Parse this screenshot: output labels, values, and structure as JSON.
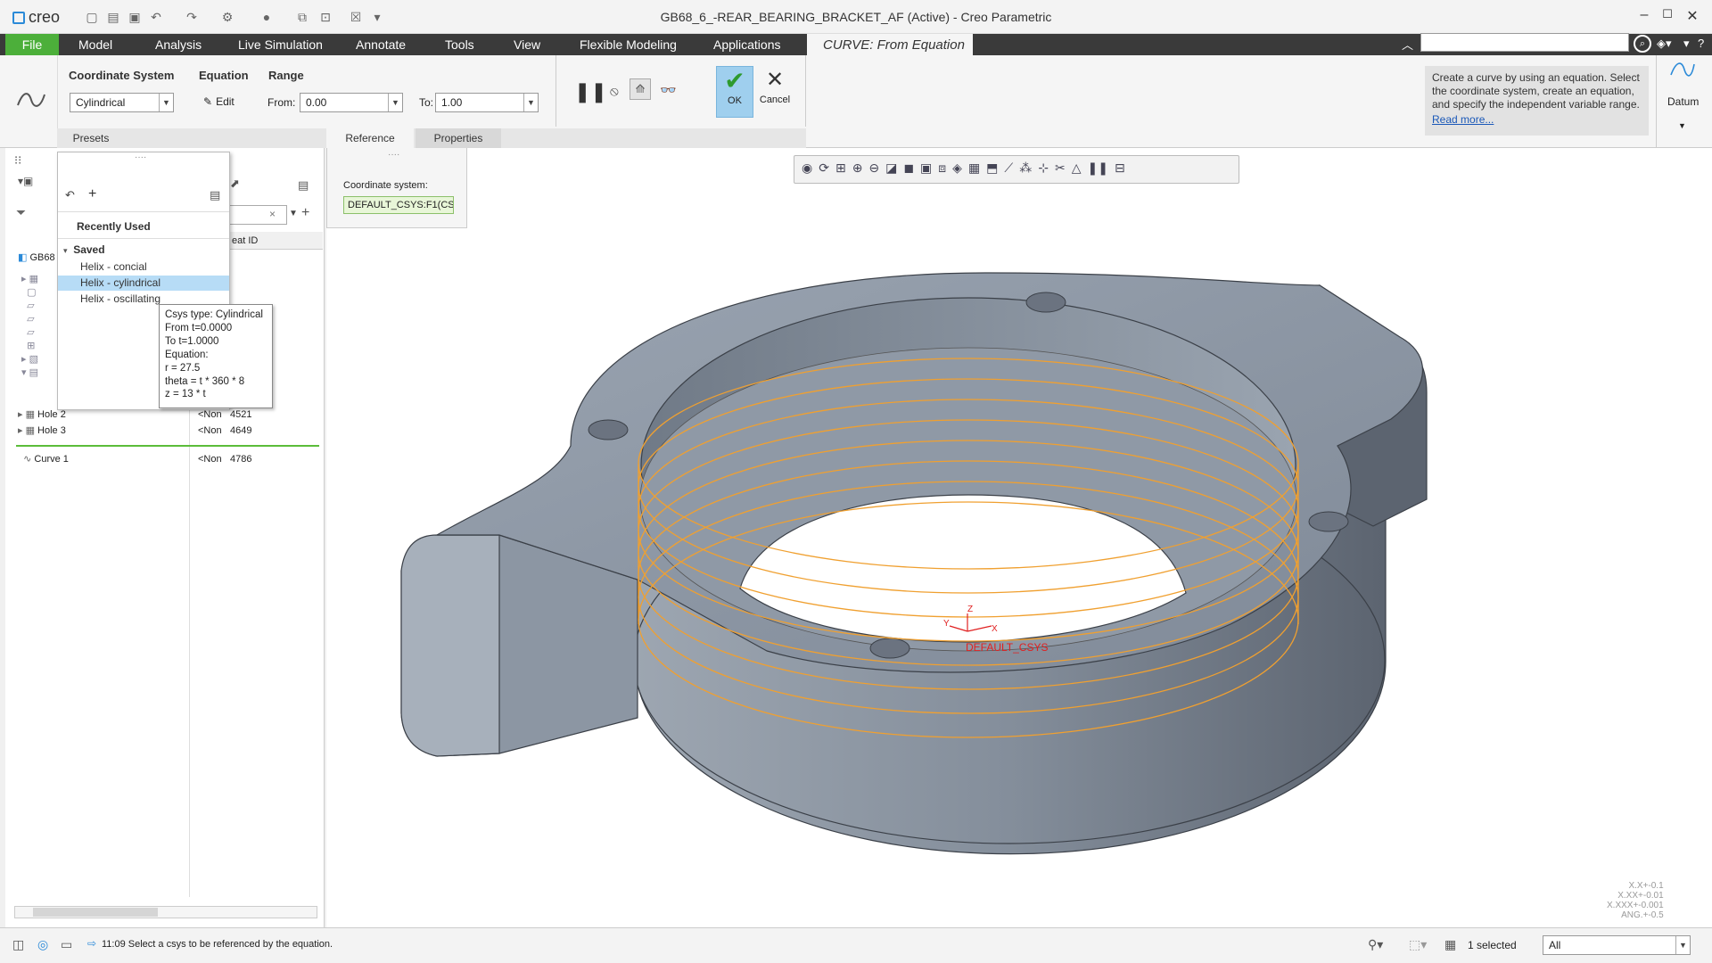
{
  "app": {
    "logo_text": "creo",
    "window_title": "GB68_6_-REAR_BEARING_BRACKET_AF (Active) - Creo Parametric",
    "window_controls": [
      "–",
      "☐",
      "✕"
    ]
  },
  "ribbon": {
    "tabs": [
      "File",
      "Model",
      "Analysis",
      "Live Simulation",
      "Annotate",
      "Tools",
      "View",
      "Flexible Modeling",
      "Applications"
    ],
    "active_tab": "CURVE: From Equation",
    "search_placeholder": ""
  },
  "dashboard": {
    "coord_system_label": "Coordinate System",
    "coord_system_value": "Cylindrical",
    "equation_label": "Equation",
    "edit_label": "Edit",
    "range_label": "Range",
    "from_label": "From:",
    "from_value": "0.00",
    "to_label": "To:",
    "to_value": "1.00",
    "ok_label": "OK",
    "cancel_label": "Cancel",
    "subtabs": [
      "Presets",
      "Reference",
      "Properties"
    ],
    "help_text": "Create a curve by using an equation. Select the coordinate system, create an equation, and specify the independent variable range.",
    "help_link": "Read more...",
    "datum_label": "Datum"
  },
  "reference_panel": {
    "coord_label": "Coordinate system:",
    "coord_value": "DEFAULT_CSYS:F1(CS"
  },
  "presets_popup": {
    "recently_used": "Recently Used",
    "saved": "Saved",
    "items": [
      "Helix - concial",
      "Helix - cylindrical",
      "Helix - oscillating"
    ],
    "selected_index": 1
  },
  "tooltip": {
    "lines": [
      "Csys type: Cylindrical",
      "From t=0.0000",
      "To t=1.0000",
      "Equation:",
      "r = 27.5",
      "theta = t * 360 * 8",
      "z = 13 * t"
    ]
  },
  "model_tree": {
    "root": "GB68",
    "feat_id_header": "eat ID",
    "rows": [
      {
        "name": "Hole 2",
        "status": "<Non",
        "id": "4521"
      },
      {
        "name": "Hole 3",
        "status": "<Non",
        "id": "4649"
      },
      {
        "name": "Curve 1",
        "status": "<Non",
        "id": "4786"
      }
    ]
  },
  "graphics": {
    "csys_label": "DEFAULT_CSYS",
    "axis_x": "X",
    "axis_y": "Y",
    "axis_z": "Z",
    "tolerances": [
      "X.X+-0.1",
      "X.XX+-0.01",
      "X.XXX+-0.001",
      "ANG.+-0.5"
    ],
    "model_color": "#8d97a5",
    "curve_color": "#f0a030"
  },
  "status": {
    "message": "11:09 Select a csys to be referenced by the equation.",
    "selected": "1 selected",
    "filter": "All"
  }
}
